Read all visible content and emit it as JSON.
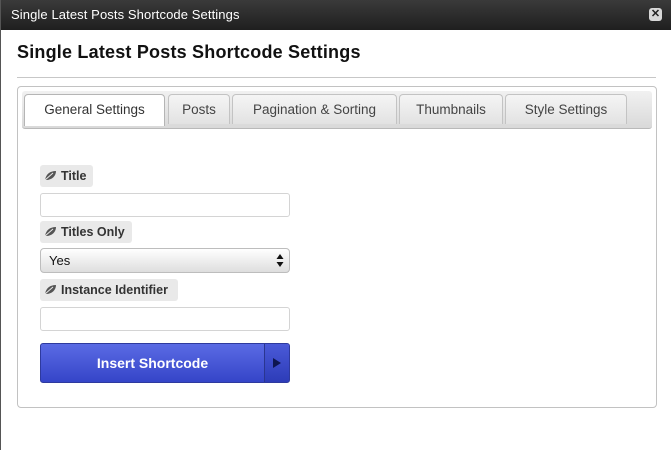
{
  "window": {
    "title": "Single Latest Posts Shortcode Settings",
    "close_glyph": "✕"
  },
  "header": {
    "title": "Single Latest Posts Shortcode Settings"
  },
  "tabs": [
    {
      "label": "General Settings",
      "active": true
    },
    {
      "label": "Posts",
      "active": false
    },
    {
      "label": "Pagination & Sorting",
      "active": false
    },
    {
      "label": "Thumbnails",
      "active": false
    },
    {
      "label": "Style Settings",
      "active": false
    }
  ],
  "form": {
    "title_field": {
      "label": "Title",
      "value": "",
      "icon": "leaf-icon"
    },
    "titles_only_field": {
      "label": "Titles Only",
      "selected": "Yes",
      "icon": "leaf-icon"
    },
    "instance_field": {
      "label": "Instance Identifier",
      "value": "",
      "icon": "leaf-icon"
    },
    "insert_button": {
      "label": "Insert Shortcode"
    }
  },
  "colors": {
    "titlebar": "#2b2b2b",
    "button": "#4555d6",
    "button_arrow": "#0e1650"
  }
}
